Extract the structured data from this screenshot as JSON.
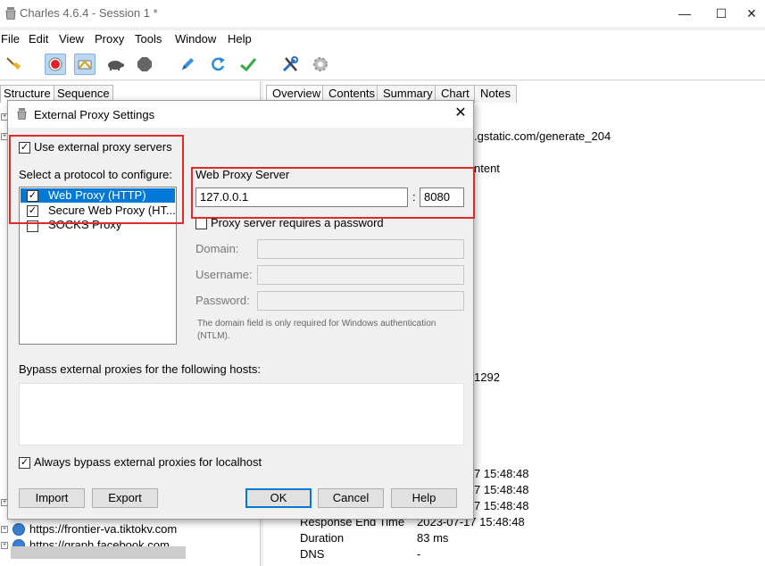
{
  "window": {
    "title": "Charles 4.6.4 - Session 1 *",
    "controls": {
      "minimize": "—",
      "maximize": "☐",
      "close": "✕"
    }
  },
  "menu": [
    "File",
    "Edit",
    "View",
    "Proxy",
    "Tools",
    "Window",
    "Help"
  ],
  "toolbar": {
    "icons": [
      "broom-icon",
      "record-icon",
      "throttle-icon",
      "turtle-icon",
      "breakpoint-icon",
      "pen-icon",
      "refresh-icon",
      "check-icon",
      "tools-icon",
      "gear-icon"
    ],
    "active": [
      "record-icon",
      "throttle-icon"
    ]
  },
  "left_tabs": [
    "Structure",
    "Sequence"
  ],
  "tree_rows": [
    "https://frontier-va.tiktokv.com",
    "https://graph.facebook.com"
  ],
  "right_tabs": [
    "Overview",
    "Contents",
    "Summary",
    "Chart",
    "Notes"
  ],
  "overview": {
    "url_fragment": ".gstatic.com/generate_204",
    "content_fragment": "ntent",
    "number_fragment": "1292",
    "times": [
      "7  15:48:48",
      "7  15:48:48",
      "7  15:48:48"
    ],
    "rows": [
      {
        "name": "Response End Time",
        "value": "2023-07-17 15:48:48"
      },
      {
        "name": "Duration",
        "value": "83 ms"
      },
      {
        "name": "DNS",
        "value": "-"
      }
    ]
  },
  "dialog": {
    "title": "External Proxy Settings",
    "use_external_label": "Use external proxy servers",
    "use_external_checked": true,
    "protocol_heading": "Select a protocol to configure:",
    "protocols": [
      {
        "label": "Web Proxy (HTTP)",
        "checked": true,
        "selected": true
      },
      {
        "label": "Secure Web Proxy (HT...",
        "checked": true,
        "selected": false
      },
      {
        "label": "SOCKS Proxy",
        "checked": false,
        "selected": false
      }
    ],
    "server_heading": "Web Proxy Server",
    "host": "127.0.0.1",
    "separator": ":",
    "port": "8080",
    "requires_password_label": "Proxy server requires a password",
    "requires_password_checked": false,
    "domain_label": "Domain:",
    "username_label": "Username:",
    "password_label": "Password:",
    "domain_note": "The domain field is only required for Windows authentication (NTLM).",
    "bypass_label": "Bypass external proxies for the following hosts:",
    "bypass_hosts": "",
    "localhost_label": "Always bypass external proxies for localhost",
    "localhost_checked": true,
    "buttons": {
      "import": "Import",
      "export": "Export",
      "ok": "OK",
      "cancel": "Cancel",
      "help": "Help"
    },
    "highlight_color": "#e02a2a",
    "selection_color": "#0078d7"
  }
}
